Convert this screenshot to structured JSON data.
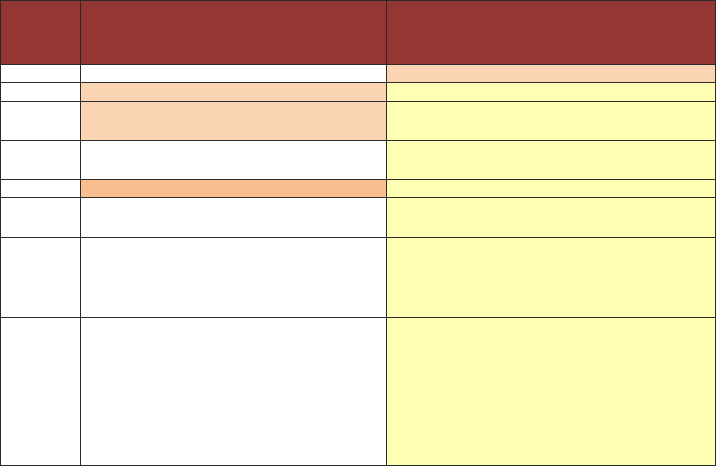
{
  "table": {
    "header": [
      "",
      "",
      ""
    ],
    "rows": [
      [
        "",
        "",
        ""
      ],
      [
        "",
        "",
        ""
      ],
      [
        "",
        "",
        ""
      ],
      [
        "",
        "",
        ""
      ],
      [
        "",
        "",
        ""
      ],
      [
        "",
        "",
        ""
      ],
      [
        "",
        "",
        ""
      ],
      [
        "",
        "",
        ""
      ]
    ]
  },
  "colors": {
    "header": "#943634",
    "peach": "#fbd4b4",
    "orange": "#fabf8f",
    "yellow": "#ffffb3",
    "white": "#ffffff",
    "border": "#2b2b2b"
  }
}
